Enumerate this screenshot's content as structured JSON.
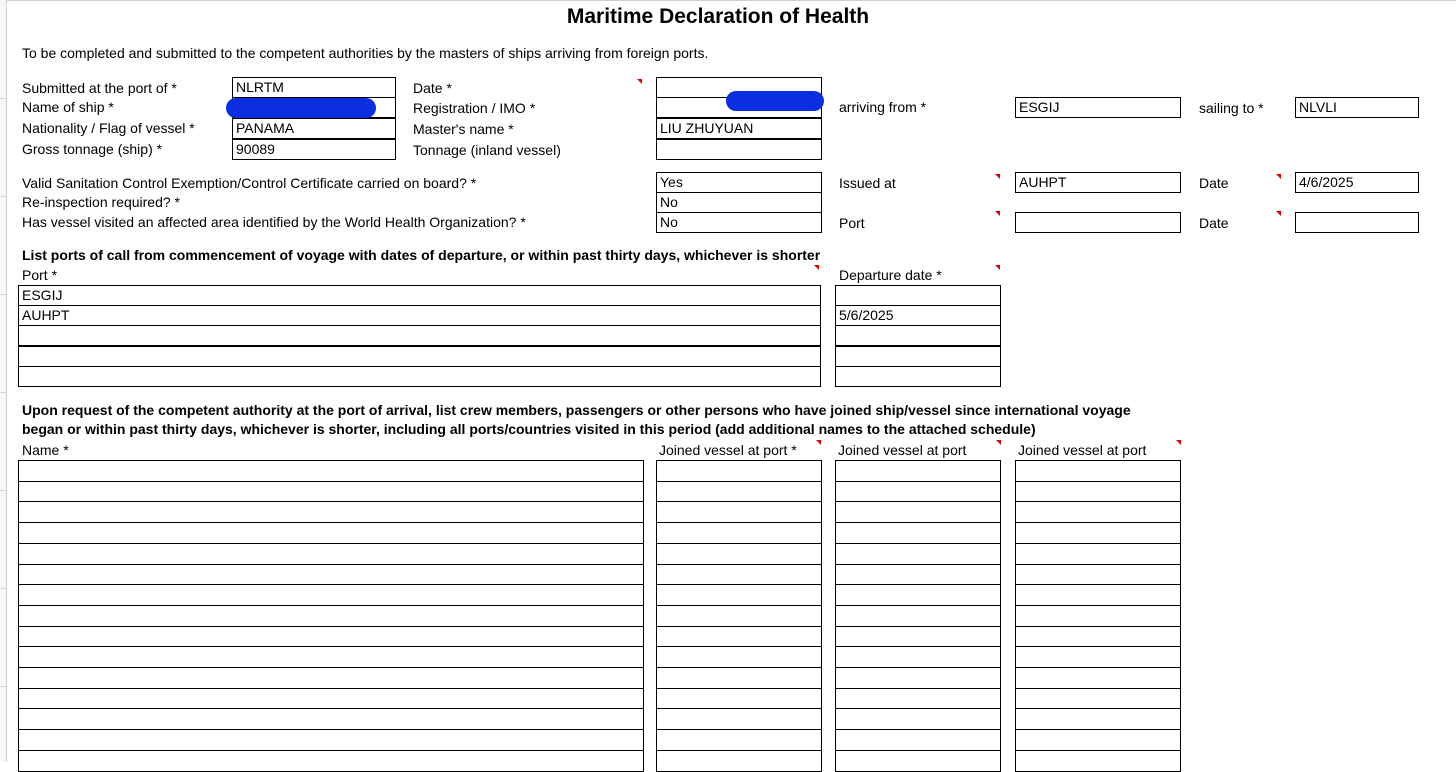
{
  "form": {
    "title": "Maritime Declaration of Health",
    "intro": "To be completed and submitted to the competent authorities by the masters of ships arriving from foreign ports.",
    "labels": {
      "submitted_port": "Submitted at the port of *",
      "name_of_ship": "Name of ship *",
      "nationality": "Nationality / Flag of vessel *",
      "gross_tonnage": "Gross tonnage (ship) *",
      "date": "Date *",
      "registration": "Registration / IMO *",
      "masters_name": "Master's name *",
      "tonnage_inland": "Tonnage (inland vessel)",
      "arriving_from": "arriving from *",
      "sailing_to": "sailing to *",
      "sanitation": "Valid Sanitation Control Exemption/Control Certificate carried on board? *",
      "reinspection": "Re-inspection required? *",
      "affected_area": "Has vessel visited an affected area identified by the World Health Organization? *",
      "issued_at": "Issued at",
      "date_plain": "Date",
      "port_plain": "Port"
    },
    "values": {
      "submitted_port": "NLRTM",
      "name_of_ship": "",
      "nationality": "PANAMA",
      "gross_tonnage": "90089",
      "date": "",
      "registration": "",
      "masters_name": "LIU ZHUYUAN",
      "tonnage_inland": "",
      "arriving_from": "ESGIJ",
      "sailing_to": "NLVLI",
      "sanitation": "Yes",
      "reinspection": "No",
      "affected_area": "No",
      "issued_at": "AUHPT",
      "issued_date": "4/6/2025",
      "affected_port": "",
      "affected_date": ""
    },
    "ports_section": {
      "heading": "List ports of call from commencement of voyage with dates of departure, or within past thirty days, whichever is shorter",
      "port_header": "Port *",
      "departure_header": "Departure date *",
      "rows": [
        {
          "port": "ESGIJ",
          "departure": ""
        },
        {
          "port": "AUHPT",
          "departure": "5/6/2025"
        },
        {
          "port": "",
          "departure": ""
        },
        {
          "port": "",
          "departure": ""
        },
        {
          "port": "",
          "departure": ""
        }
      ]
    },
    "crew_section": {
      "heading_line1": "Upon request of the competent authority at the port of arrival, list crew members, passengers or other persons who have joined ship/vessel since international voyage",
      "heading_line2": "began or within past thirty days, whichever is shorter, including all ports/countries visited in this period (add additional names to the attached schedule)",
      "name_header": "Name *",
      "joined_header_1": "Joined vessel at port *",
      "joined_header_2": "Joined vessel at port",
      "joined_header_3": "Joined vessel at port",
      "rows": [
        {
          "name": "",
          "j1": "",
          "j2": "",
          "j3": ""
        },
        {
          "name": "",
          "j1": "",
          "j2": "",
          "j3": ""
        },
        {
          "name": "",
          "j1": "",
          "j2": "",
          "j3": ""
        },
        {
          "name": "",
          "j1": "",
          "j2": "",
          "j3": ""
        },
        {
          "name": "",
          "j1": "",
          "j2": "",
          "j3": ""
        },
        {
          "name": "",
          "j1": "",
          "j2": "",
          "j3": ""
        },
        {
          "name": "",
          "j1": "",
          "j2": "",
          "j3": ""
        },
        {
          "name": "",
          "j1": "",
          "j2": "",
          "j3": ""
        },
        {
          "name": "",
          "j1": "",
          "j2": "",
          "j3": ""
        },
        {
          "name": "",
          "j1": "",
          "j2": "",
          "j3": ""
        },
        {
          "name": "",
          "j1": "",
          "j2": "",
          "j3": ""
        },
        {
          "name": "",
          "j1": "",
          "j2": "",
          "j3": ""
        },
        {
          "name": "",
          "j1": "",
          "j2": "",
          "j3": ""
        },
        {
          "name": "",
          "j1": "",
          "j2": "",
          "j3": ""
        },
        {
          "name": "",
          "j1": "",
          "j2": "",
          "j3": ""
        }
      ]
    },
    "colors": {
      "redaction": "#0a2ee0",
      "comment_marker": "#e00000"
    },
    "icons": {
      "comment_marker": "comment-indicator-icon"
    }
  }
}
